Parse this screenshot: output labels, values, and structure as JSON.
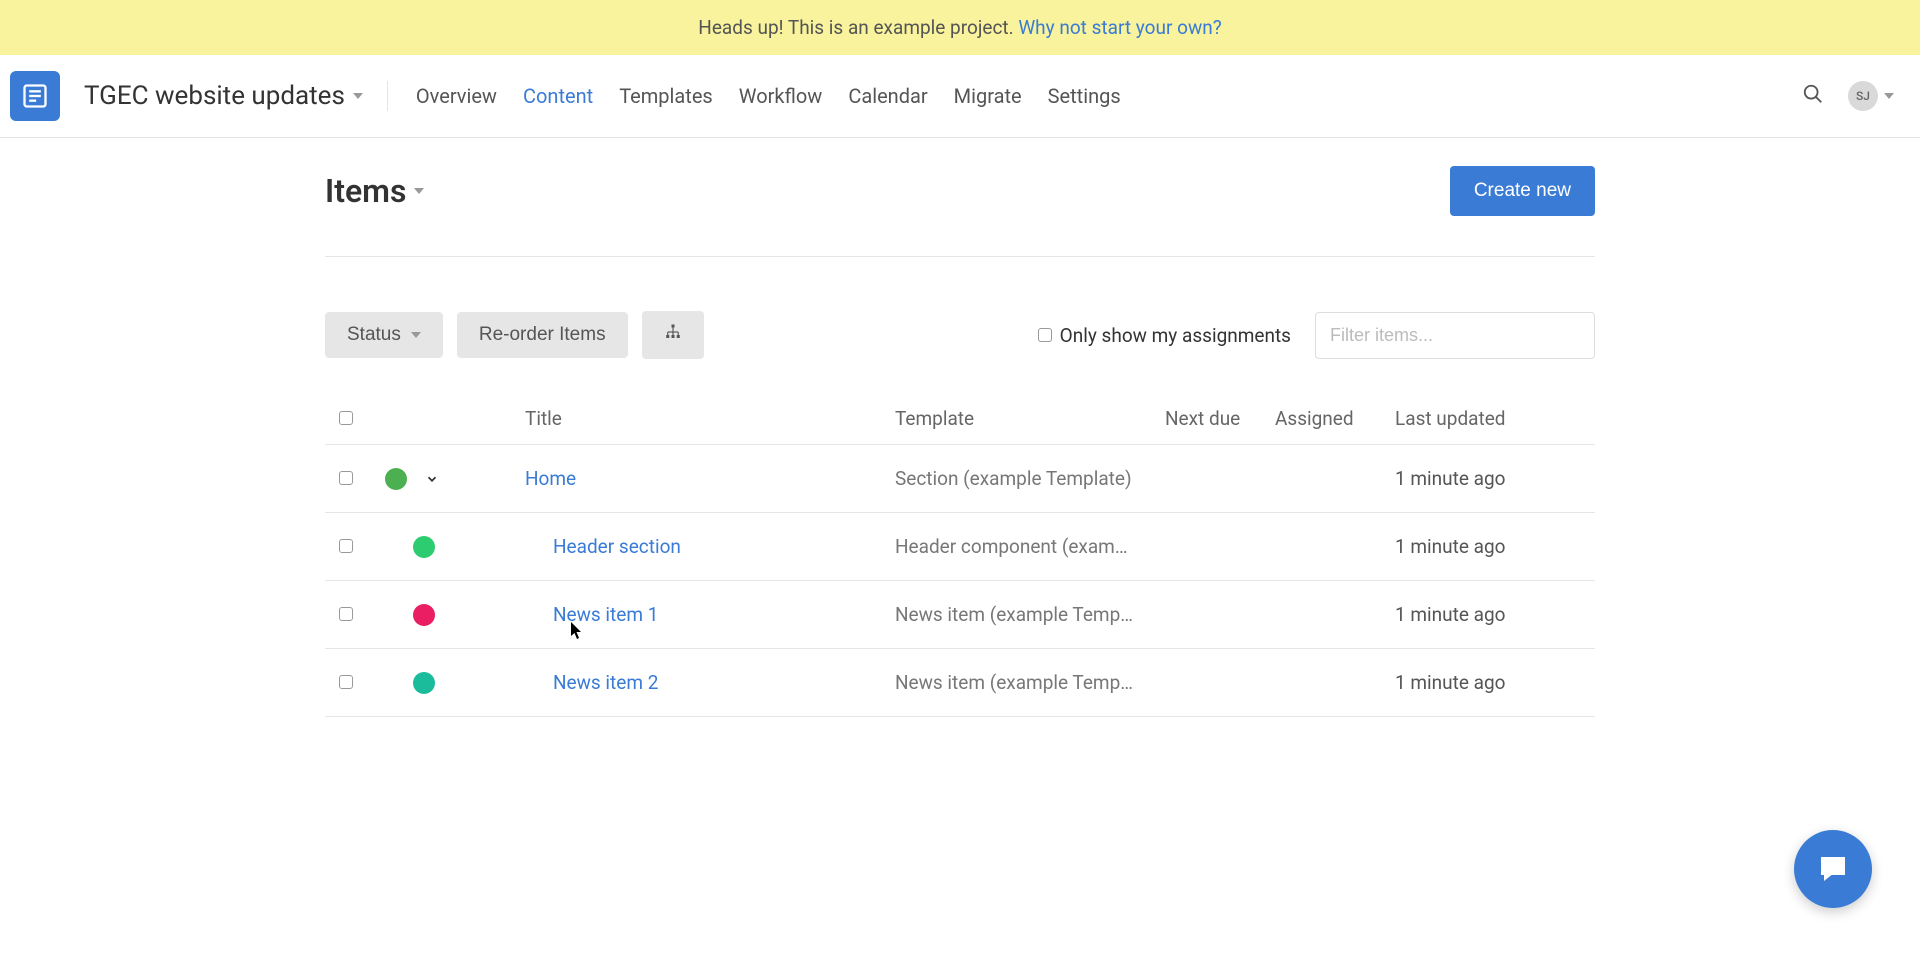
{
  "banner": {
    "text": "Heads up! This is an example project. ",
    "link_text": "Why not start your own?"
  },
  "header": {
    "project_name": "TGEC website updates",
    "user_initials": "SJ",
    "nav": [
      {
        "label": "Overview",
        "active": false
      },
      {
        "label": "Content",
        "active": true
      },
      {
        "label": "Templates",
        "active": false
      },
      {
        "label": "Workflow",
        "active": false
      },
      {
        "label": "Calendar",
        "active": false
      },
      {
        "label": "Migrate",
        "active": false
      },
      {
        "label": "Settings",
        "active": false
      }
    ]
  },
  "page": {
    "title": "Items",
    "create_button": "Create new"
  },
  "toolbar": {
    "status_button": "Status",
    "reorder_button": "Re-order Items",
    "only_mine_label": "Only show my assignments",
    "filter_placeholder": "Filter items..."
  },
  "table": {
    "headers": {
      "title": "Title",
      "template": "Template",
      "next_due": "Next due",
      "assigned": "Assigned",
      "last_updated": "Last updated"
    },
    "rows": [
      {
        "status_color": "dot-green",
        "expandable": true,
        "child": false,
        "title": "Home",
        "template": "Section (example Template)",
        "next_due": "",
        "assigned": "",
        "last_updated": "1 minute ago"
      },
      {
        "status_color": "dot-green2",
        "expandable": false,
        "child": true,
        "title": "Header section",
        "template": "Header component (exam…",
        "next_due": "",
        "assigned": "",
        "last_updated": "1 minute ago"
      },
      {
        "status_color": "dot-pink",
        "expandable": false,
        "child": true,
        "title": "News item 1",
        "template": "News item (example Temp…",
        "next_due": "",
        "assigned": "",
        "last_updated": "1 minute ago"
      },
      {
        "status_color": "dot-teal",
        "expandable": false,
        "child": true,
        "title": "News item 2",
        "template": "News item (example Temp…",
        "next_due": "",
        "assigned": "",
        "last_updated": "1 minute ago"
      }
    ]
  }
}
